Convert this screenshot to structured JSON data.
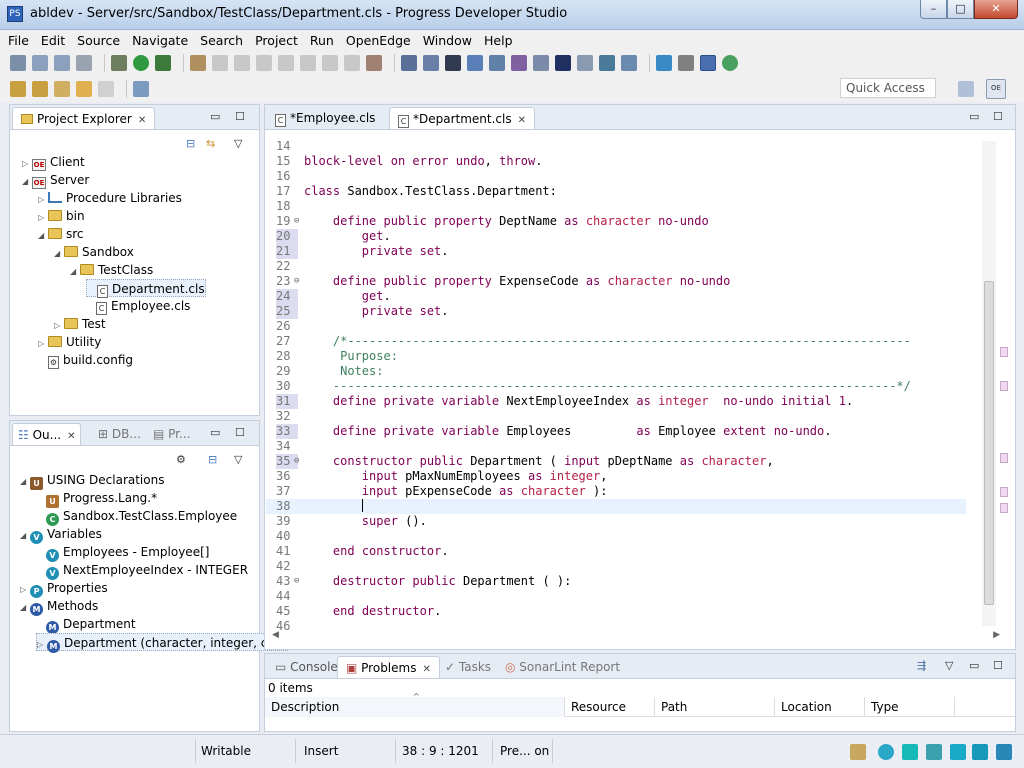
{
  "window": {
    "title": "abldev - Server/src/Sandbox/TestClass/Department.cls - Progress Developer Studio",
    "minimize": "–",
    "maximize": "□",
    "close": "✕"
  },
  "menu": [
    "File",
    "Edit",
    "Source",
    "Navigate",
    "Search",
    "Project",
    "Run",
    "OpenEdge",
    "Window",
    "Help"
  ],
  "quick_access": "Quick Access",
  "project_explorer": {
    "tab_label": "Project Explorer",
    "items": [
      {
        "label": "Client",
        "depth": 0,
        "arrow": "▷",
        "icon": "project"
      },
      {
        "label": "Server",
        "depth": 0,
        "arrow": "◢",
        "icon": "project"
      },
      {
        "label": "Procedure Libraries",
        "depth": 1,
        "arrow": "▷",
        "icon": "library"
      },
      {
        "label": "bin",
        "depth": 1,
        "arrow": "▷",
        "icon": "folder"
      },
      {
        "label": "src",
        "depth": 1,
        "arrow": "◢",
        "icon": "folder"
      },
      {
        "label": "Sandbox",
        "depth": 2,
        "arrow": "◢",
        "icon": "folder"
      },
      {
        "label": "TestClass",
        "depth": 3,
        "arrow": "◢",
        "icon": "folder"
      },
      {
        "label": "Department.cls",
        "depth": 4,
        "arrow": "",
        "icon": "file",
        "selected": true
      },
      {
        "label": "Employee.cls",
        "depth": 4,
        "arrow": "",
        "icon": "file"
      },
      {
        "label": "Test",
        "depth": 2,
        "arrow": "▷",
        "icon": "folder"
      },
      {
        "label": "Utility",
        "depth": 1,
        "arrow": "▷",
        "icon": "folder"
      },
      {
        "label": "build.config",
        "depth": 1,
        "arrow": "",
        "icon": "config"
      }
    ]
  },
  "outline": {
    "tabs": [
      "Ou...",
      "DB...",
      "Pr..."
    ],
    "items": [
      {
        "label": "USING Declarations",
        "depth": 0,
        "arrow": "◢",
        "icon": "using",
        "color": "#8b5a2b",
        "glyph": "U"
      },
      {
        "label": "Progress.Lang.*",
        "depth": 1,
        "arrow": "",
        "icon": "using",
        "color": "#b07030",
        "glyph": "U"
      },
      {
        "label": "Sandbox.TestClass.Employee",
        "depth": 1,
        "arrow": "",
        "icon": "class",
        "color": "#2e9a55",
        "glyph": "C"
      },
      {
        "label": "Variables",
        "depth": 0,
        "arrow": "◢",
        "icon": "variable",
        "color": "#1f8fb5",
        "glyph": "V"
      },
      {
        "label": "Employees - Employee[]",
        "depth": 1,
        "arrow": "",
        "icon": "variable",
        "color": "#1f8fb5",
        "glyph": "V"
      },
      {
        "label": "NextEmployeeIndex - INTEGER",
        "depth": 1,
        "arrow": "",
        "icon": "variable",
        "color": "#1f8fb5",
        "glyph": "V"
      },
      {
        "label": "Properties",
        "depth": 0,
        "arrow": "▷",
        "icon": "property",
        "color": "#1f8fb5",
        "glyph": "P"
      },
      {
        "label": "Methods",
        "depth": 0,
        "arrow": "◢",
        "icon": "method",
        "color": "#2e5aa8",
        "glyph": "M"
      },
      {
        "label": "Department",
        "depth": 1,
        "arrow": "",
        "icon": "method",
        "color": "#2e5aa8",
        "glyph": "M"
      },
      {
        "label": "Department (character, integer, char",
        "depth": 1,
        "arrow": "▷",
        "icon": "method",
        "color": "#2e5aa8",
        "glyph": "M",
        "selected": true
      }
    ]
  },
  "editor": {
    "tabs": [
      {
        "label": "*Employee.cls",
        "active": false
      },
      {
        "label": "*Department.cls",
        "active": true
      }
    ],
    "lines": [
      {
        "n": "14",
        "text": ""
      },
      {
        "n": "15",
        "text": "block-level on error undo, throw."
      },
      {
        "n": "16",
        "text": ""
      },
      {
        "n": "17",
        "text": "class Sandbox.TestClass.Department:"
      },
      {
        "n": "18",
        "text": ""
      },
      {
        "n": "19",
        "text": "    define public property DeptName as character no-undo",
        "fold": true
      },
      {
        "n": "20",
        "text": "        get.",
        "mark": true
      },
      {
        "n": "21",
        "text": "        private set.",
        "mark": true
      },
      {
        "n": "22",
        "text": ""
      },
      {
        "n": "23",
        "text": "    define public property ExpenseCode as character no-undo",
        "fold": true
      },
      {
        "n": "24",
        "text": "        get.",
        "mark": true
      },
      {
        "n": "25",
        "text": "        private set.",
        "mark": true
      },
      {
        "n": "26",
        "text": ""
      },
      {
        "n": "27",
        "text": "    /*------------------------------------------------------------------------------"
      },
      {
        "n": "28",
        "text": "     Purpose:"
      },
      {
        "n": "29",
        "text": "     Notes:"
      },
      {
        "n": "30",
        "text": "    ------------------------------------------------------------------------------*/"
      },
      {
        "n": "31",
        "text": "    define private variable NextEmployeeIndex as integer  no-undo initial 1.",
        "mark": true
      },
      {
        "n": "32",
        "text": ""
      },
      {
        "n": "33",
        "text": "    define private variable Employees         as Employee extent no-undo.",
        "mark": true
      },
      {
        "n": "34",
        "text": ""
      },
      {
        "n": "35",
        "text": "    constructor public Department ( input pDeptName as character,",
        "fold": true,
        "mark": true
      },
      {
        "n": "36",
        "text": "        input pMaxNumEmployees as integer,"
      },
      {
        "n": "37",
        "text": "        input pExpenseCode as character ):"
      },
      {
        "n": "38",
        "text": "        ",
        "current": true
      },
      {
        "n": "39",
        "text": "        super ()."
      },
      {
        "n": "40",
        "text": ""
      },
      {
        "n": "41",
        "text": "    end constructor."
      },
      {
        "n": "42",
        "text": ""
      },
      {
        "n": "43",
        "text": "    destructor public Department ( ):",
        "fold": true
      },
      {
        "n": "44",
        "text": ""
      },
      {
        "n": "45",
        "text": "    end destructor."
      },
      {
        "n": "46",
        "text": ""
      }
    ]
  },
  "bottom_panel": {
    "tabs": [
      "Console",
      "Problems",
      "Tasks",
      "SonarLint Report"
    ],
    "active_tab": "Problems",
    "summary": "0 items",
    "columns": [
      "Description",
      "Resource",
      "Path",
      "Location",
      "Type"
    ]
  },
  "status": {
    "writable": "Writable",
    "insert": "Insert",
    "position": "38 : 9 : 1201",
    "preview": "Pre... on"
  },
  "colors": {
    "keyword": "#7f0055",
    "type": "#b5204a",
    "comment": "#3f7f5f"
  }
}
